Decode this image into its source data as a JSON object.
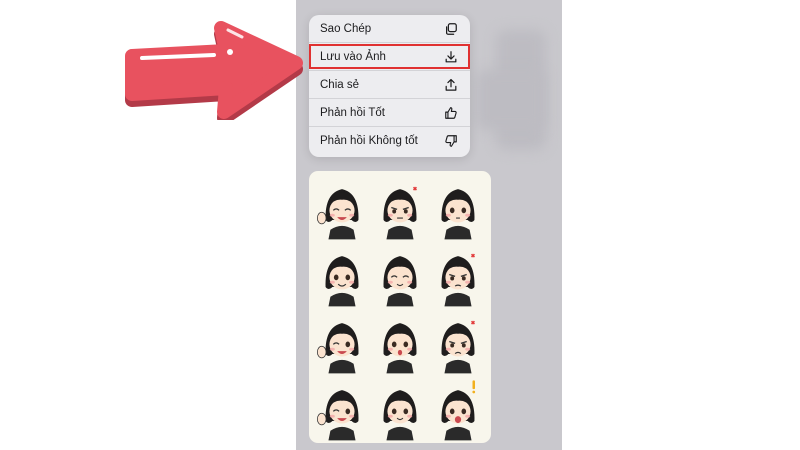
{
  "context_menu": {
    "items": [
      {
        "label": "Sao Chép",
        "icon": "copy-icon"
      },
      {
        "label": "Lưu vào Ảnh",
        "icon": "download-icon"
      },
      {
        "label": "Chia sẻ",
        "icon": "share-icon"
      },
      {
        "label": "Phản hồi Tốt",
        "icon": "thumbs-up-icon"
      },
      {
        "label": "Phản hồi Không tốt",
        "icon": "thumbs-down-icon"
      }
    ]
  },
  "colors": {
    "highlight": "#e03131",
    "arrow": "#e8525f",
    "menu_bg": "#ededf0",
    "screen_bg": "#c9c8cd",
    "card_bg": "#f8f6ec"
  },
  "preview": {
    "stickers": [
      {
        "mood": "waving-happy"
      },
      {
        "mood": "annoyed"
      },
      {
        "mood": "neutral"
      },
      {
        "mood": "smiling"
      },
      {
        "mood": "content"
      },
      {
        "mood": "angry"
      },
      {
        "mood": "waving-wink"
      },
      {
        "mood": "blushing"
      },
      {
        "mood": "angry-frown"
      },
      {
        "mood": "waving-wink"
      },
      {
        "mood": "hands-clasped"
      },
      {
        "mood": "surprised"
      }
    ]
  }
}
